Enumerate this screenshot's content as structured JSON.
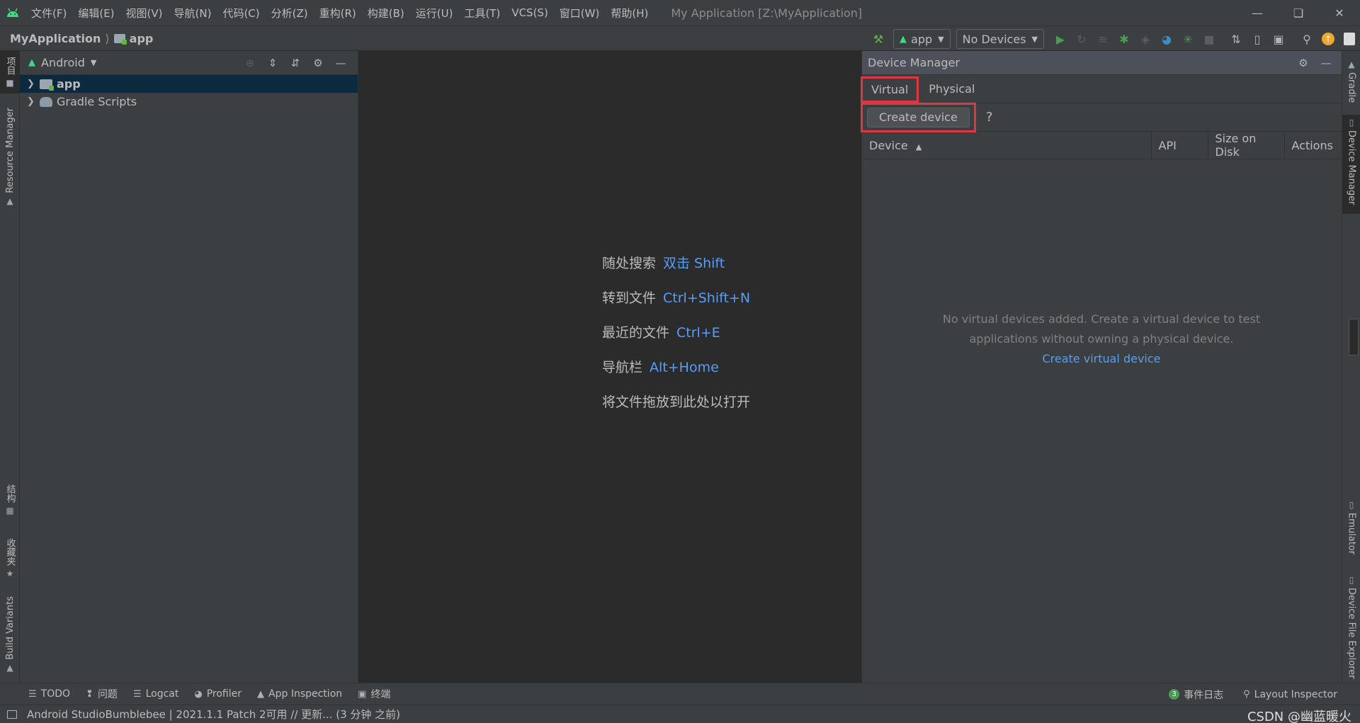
{
  "titlebar": {
    "menu": [
      "文件(F)",
      "编辑(E)",
      "视图(V)",
      "导航(N)",
      "代码(C)",
      "分析(Z)",
      "重构(R)",
      "构建(B)",
      "运行(U)",
      "工具(T)",
      "VCS(S)",
      "窗口(W)",
      "帮助(H)"
    ],
    "title": "My Application [Z:\\MyApplication]"
  },
  "navbar": {
    "project": "MyApplication",
    "module": "app",
    "run_config": "app",
    "device": "No Devices"
  },
  "left_strip": {
    "project_tab": "项目",
    "resource_manager": "Resource Manager",
    "structure": "结构",
    "favorites": "收藏夹",
    "build_variants": "Build Variants"
  },
  "project_panel": {
    "view_mode": "Android",
    "tree": [
      {
        "label": "app",
        "selected": true,
        "icon": "module-folder-icon"
      },
      {
        "label": "Gradle Scripts",
        "selected": false,
        "icon": "gradle-icon"
      }
    ]
  },
  "editor": {
    "hints": [
      {
        "text": "随处搜索",
        "key": "双击 Shift"
      },
      {
        "text": "转到文件",
        "key": "Ctrl+Shift+N"
      },
      {
        "text": "最近的文件",
        "key": "Ctrl+E"
      },
      {
        "text": "导航栏",
        "key": "Alt+Home"
      },
      {
        "text": "将文件拖放到此处以打开",
        "key": ""
      }
    ]
  },
  "device_manager": {
    "title": "Device Manager",
    "tabs": [
      "Virtual",
      "Physical"
    ],
    "create_button": "Create device",
    "help": "?",
    "columns": [
      "Device",
      "API",
      "Size on Disk",
      "Actions"
    ],
    "sort_indicator": "▲",
    "empty_line1": "No virtual devices added. Create a virtual device to test",
    "empty_line2": "applications without owning a physical device.",
    "empty_link": "Create virtual device"
  },
  "right_strip": {
    "gradle": "Gradle",
    "device_manager": "Device Manager",
    "emulator": "Emulator",
    "device_file_explorer": "Device File Explorer"
  },
  "bottom_bar": {
    "tabs": [
      "TODO",
      "问题",
      "Logcat",
      "Profiler",
      "App Inspection",
      "终端"
    ],
    "event_log_count": "3",
    "event_log": "事件日志",
    "layout_inspector": "Layout Inspector"
  },
  "status_bar": {
    "message": "Android StudioBumblebee | 2021.1.1 Patch 2可用 // 更新... (3 分钟 之前)",
    "watermark": "CSDN @幽蓝暖火"
  },
  "colors": {
    "background": "#2b2b2b",
    "panel": "#3c3f41",
    "accent_blue": "#589df6",
    "highlight_red": "#e0363f",
    "android_green": "#3ddc84",
    "run_green": "#499c54"
  }
}
